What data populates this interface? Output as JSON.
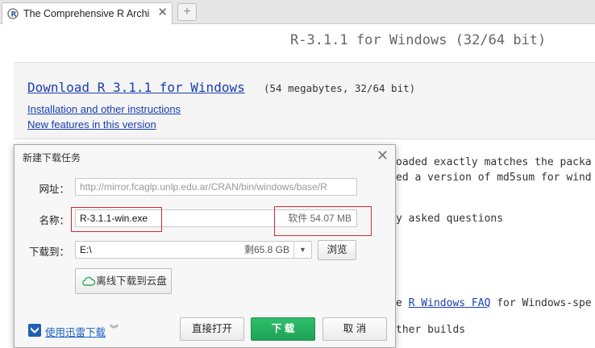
{
  "browser": {
    "tab_title": "The Comprehensive R Archi",
    "tab_close": "✕",
    "new_tab": "+"
  },
  "page": {
    "heading": "R-3.1.1 for Windows (32/64 bit)",
    "download_link": "Download R 3.1.1 for Windows",
    "download_note": "(54 megabytes, 32/64 bit)",
    "install_link": "Installation and other instructions",
    "features_link": "New features in this version",
    "bg_lines": [
      "oaded exactly matches the packa",
      "ed a version of md5sum for wind",
      "y asked questions"
    ],
    "faq_prefix": "e ",
    "faq_link": "R Windows FAQ",
    "faq_suffix": " for Windows-spe",
    "builds_text": "ther builds"
  },
  "dialog": {
    "title": "新建下载任务",
    "close": "✕",
    "url_label": "网址：",
    "url_value": "http://mirror.fcaglp.unlp.edu.ar/CRAN/bin/windows/base/R",
    "name_label": "名称：",
    "name_value": "R-3.1.1-win.exe",
    "size_value": "软件 54.07 MB",
    "path_label": "下载到：",
    "path_value": "E:\\",
    "free_value": "剩65.8 GB",
    "browse_label": "浏览",
    "cloud_label": "离线下载到云盘",
    "xunlei_label": "使用迅雷下载",
    "open_label": "直接打开",
    "download_label": "下 载",
    "cancel_label": "取 消"
  },
  "colors": {
    "link": "#1a3fb0",
    "download_button": "#22a85c",
    "annotation": "#d42a2a"
  },
  "icons": {
    "tab_favicon": "r-logo-icon",
    "cloud": "cloud-icon",
    "xunlei": "xunlei-icon",
    "dropdown": "chevron-down-icon"
  }
}
